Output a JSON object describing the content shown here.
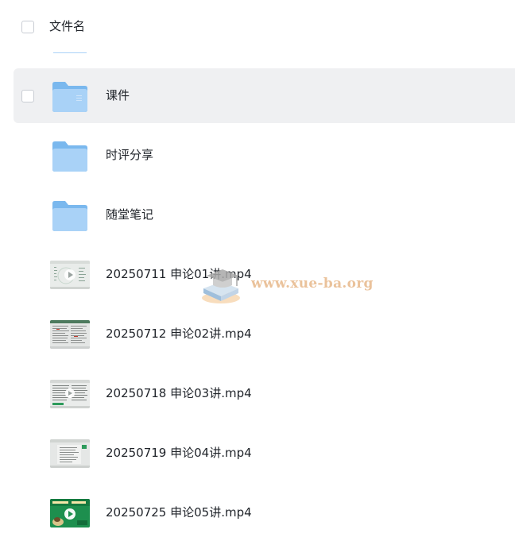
{
  "header": {
    "column_label": "文件名"
  },
  "files": [
    {
      "name": "课件",
      "type": "folder",
      "icon": "folder-icon",
      "hovered": true
    },
    {
      "name": "时评分享",
      "type": "folder",
      "icon": "folder-icon",
      "hovered": false
    },
    {
      "name": "随堂笔记",
      "type": "folder",
      "icon": "folder-icon",
      "hovered": false
    },
    {
      "name": "20250711 申论01讲.mp4",
      "type": "video",
      "icon": "video-thumbnail",
      "hovered": false
    },
    {
      "name": "20250712 申论02讲.mp4",
      "type": "video",
      "icon": "video-thumbnail",
      "hovered": false
    },
    {
      "name": "20250718 申论03讲.mp4",
      "type": "video",
      "icon": "video-thumbnail",
      "hovered": false
    },
    {
      "name": "20250719 申论04讲.mp4",
      "type": "video",
      "icon": "video-thumbnail",
      "hovered": false
    },
    {
      "name": "20250725 申论05讲.mp4",
      "type": "video",
      "icon": "video-thumbnail",
      "hovered": false
    }
  ],
  "watermark": {
    "text": "www.xue-ba.org"
  },
  "colors": {
    "folder_front": "#a9d2f7",
    "folder_back": "#7ab8ee",
    "hover_row": "#eff0f2",
    "watermark": "#e7b88a",
    "video_green": "#1d8f4e"
  }
}
